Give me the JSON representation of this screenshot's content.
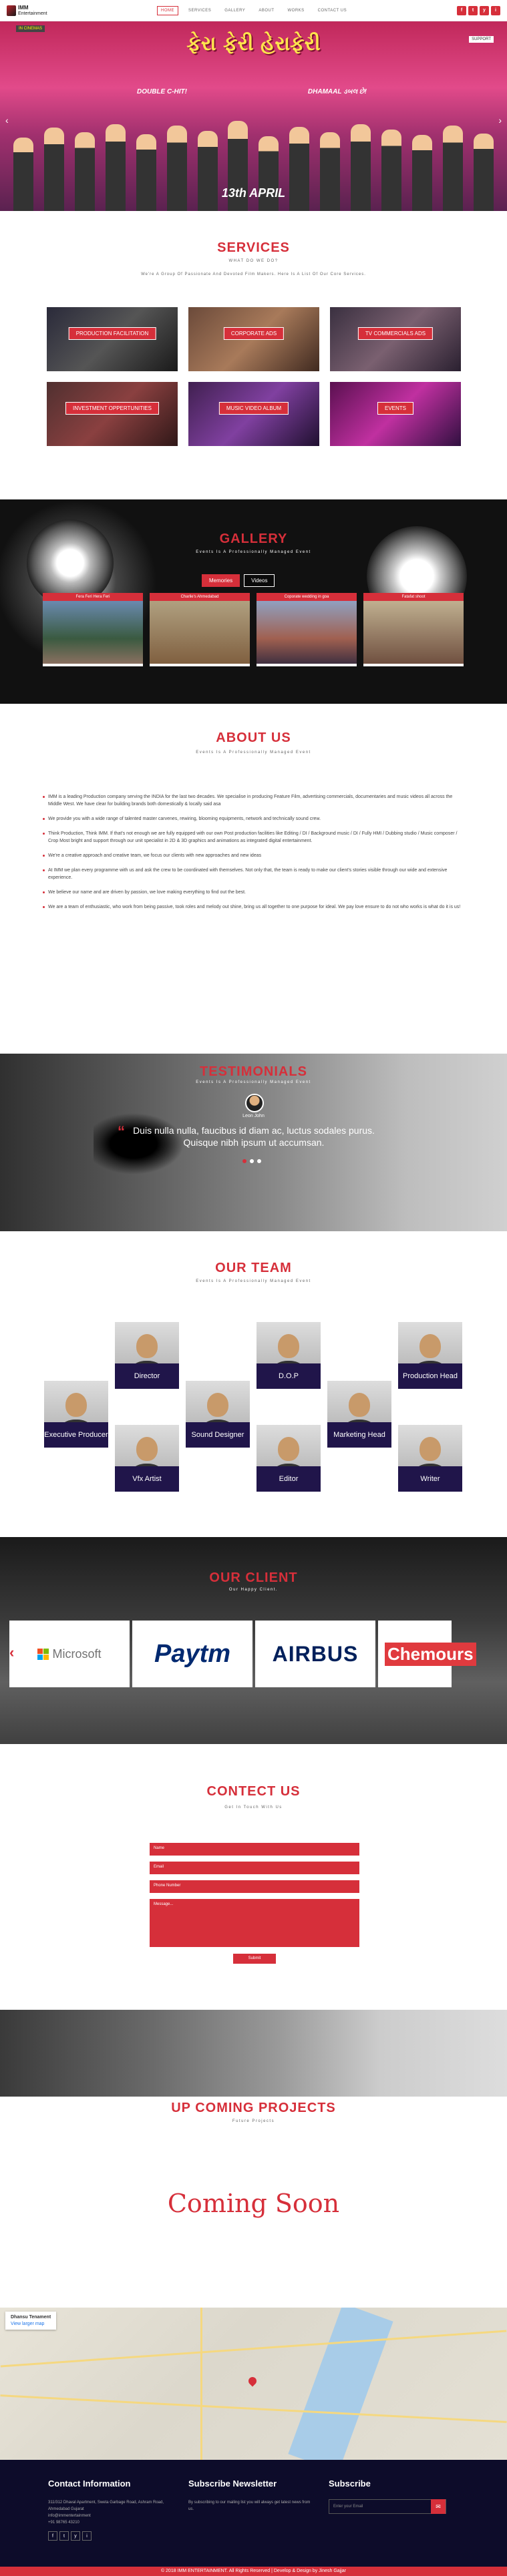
{
  "nav": {
    "logo_line1": "IMM",
    "logo_line2": "Entertainment",
    "items": [
      "HOME",
      "SERVICES",
      "GALLERY",
      "ABOUT",
      "WORKS",
      "CONTACT US"
    ],
    "social": [
      "f",
      "t",
      "y",
      "i"
    ]
  },
  "hero": {
    "title": "ફેરા ફેરી હેરાફેરી",
    "tag_left": "DOUBLE C-HIT!",
    "tag_right": "DHAMAAL ડબલ છે!",
    "release": "13th APRIL",
    "badge_left": "IN CINEMAS",
    "badge_right": "SUPPORT"
  },
  "services": {
    "title": "SERVICES",
    "subtitle": "WHAT DO WE DO?",
    "desc": "We're A Group Of Passionate And Devoted Film Makers. Here Is A List Of Our Core Services.",
    "items": [
      "PRODUCTION FACILITATION",
      "CORPORATE ADS",
      "TV COMMERCIALS ADS",
      "INVESTMENT OPPERTUNITIES",
      "MUSIC VIDEO ALBUM",
      "EVENTS"
    ]
  },
  "gallery": {
    "title": "GALLERY",
    "subtitle": "Events Is A Professionally Managed Event",
    "tabs": [
      "Memories",
      "Videos"
    ],
    "items": [
      "Fera Feri Hera Feri",
      "Charlie's Ahmedabad",
      "Coporate wedding in goa",
      "Fatafat shoot"
    ]
  },
  "about": {
    "title": "ABOUT US",
    "subtitle": "Events Is A Professionally Managed Event",
    "points": [
      "IMM is a leading Production company serving the INDIA for the last two decades. We specialise in producing Feature Film, advertising commercials, documentaries and music videos all across the Middle West. We have clear for building brands both domestically & locally said asa",
      "We provide you with a wide range of talented master carvenes, rewiring, blooming equipments, network and technically sound crew.",
      "Think Production, Think IMM. If that's not enough we are fully equipped with our own Post production facilities like Editing / DI / Background music / DI / Fully HMI / Dubbing studio / Music composer / Crop Most bright and support through our unit specialist in 2D & 3D graphics and animations as integrated digital entertainment.",
      "We're a creative approach and creative team, we focus our clients with new approaches and new ideas",
      "At IMM we plan every programme with us and ask the crew to be coordinated with themselves. Not only that, the team is ready to make our client's stories visible through our wide and extensive experience.",
      "We believe our name and are driven by passion, we love making everything to find out the best.",
      "We are a team of enthusiastic, who work from being passive, took roles and melody out shine, bring us all together to one purpose for ideal. We pay love ensure to do not who works is what do it is us!"
    ]
  },
  "testimonials": {
    "title": "TESTIMONIALS",
    "subtitle": "Events Is A Professionally Managed Event",
    "name": "Leon John",
    "quote": "Duis nulla nulla, faucibus id diam ac, luctus sodales purus. Quisque nibh ipsum ut accumsan."
  },
  "team": {
    "title": "OUR TEAM",
    "subtitle": "Events Is A Professionally Managed Event",
    "members": [
      "Director",
      "D.O.P",
      "Production Head",
      "Executive Producer",
      "Sound Designer",
      "Marketing Head",
      "Vfx Artist",
      "Editor",
      "Writer"
    ]
  },
  "clients": {
    "title": "OUR CLIENT",
    "subtitle": "Our Happy Client.",
    "logos": [
      "Microsoft",
      "Paytm",
      "AIRBUS",
      "Chemours"
    ]
  },
  "contact": {
    "title": "CONTECT US",
    "subtitle": "Get In Touch With Us",
    "placeholders": [
      "Name",
      "Email",
      "Phone Number",
      "Message..."
    ],
    "submit": "Submit"
  },
  "projects": {
    "title": "UP COMING PROJECTS",
    "subtitle": "Future Projects",
    "coming": "Coming Soon"
  },
  "map": {
    "label": "Dhansu Tenament",
    "link": "View larger map"
  },
  "footer": {
    "contact_title": "Contact Information",
    "contact_address": "311/312 Dhaval Apartment, Sweta Garbage Road, Ashram Road, Ahmedabad Gujarat",
    "contact_email": "info@immentertainment",
    "contact_phone": "+91 98765 43210",
    "newsletter_title": "Subscribe Newsletter",
    "newsletter_text": "By subscribing to our mailing list you will always get latest news from us.",
    "subscribe_title": "Subscribe",
    "subscribe_placeholder": "Enter your Email",
    "copyright": "© 2018 IMM ENTERTAINMENT. All Rights Reserved | Develop & Design by Jinesh Gajjar"
  },
  "colors": {
    "accent": "#d62f3a",
    "footer_bg": "#0d0c2a",
    "team_label": "#20154a"
  }
}
